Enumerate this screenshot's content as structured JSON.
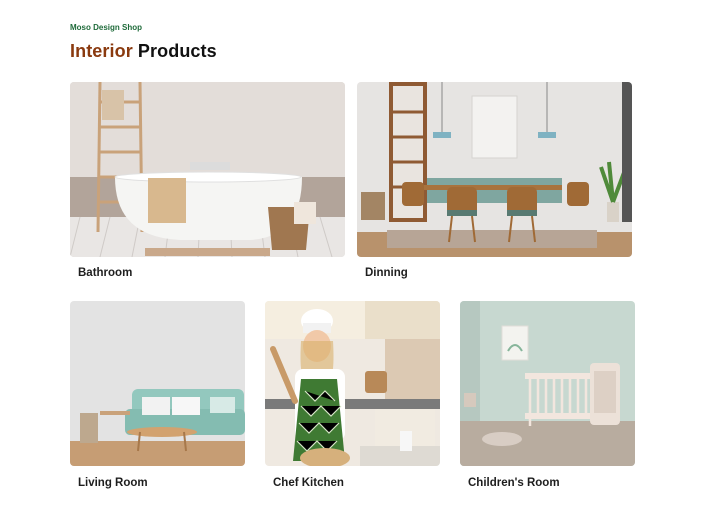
{
  "header": {
    "shop_name": "Moso Design Shop",
    "title_accent": "Interior",
    "title_rest": "Products",
    "accent_color": "#8a3a0f",
    "shop_name_color": "#1f6b3a"
  },
  "products": [
    {
      "label": "Bathroom",
      "image": "bathroom-photo"
    },
    {
      "label": "Dinning",
      "image": "dining-room-photo"
    },
    {
      "label": "Living Room",
      "image": "living-room-photo"
    },
    {
      "label": "Chef Kitchen",
      "image": "kitchen-chef-photo"
    },
    {
      "label": "Children's Room",
      "image": "nursery-photo"
    }
  ]
}
